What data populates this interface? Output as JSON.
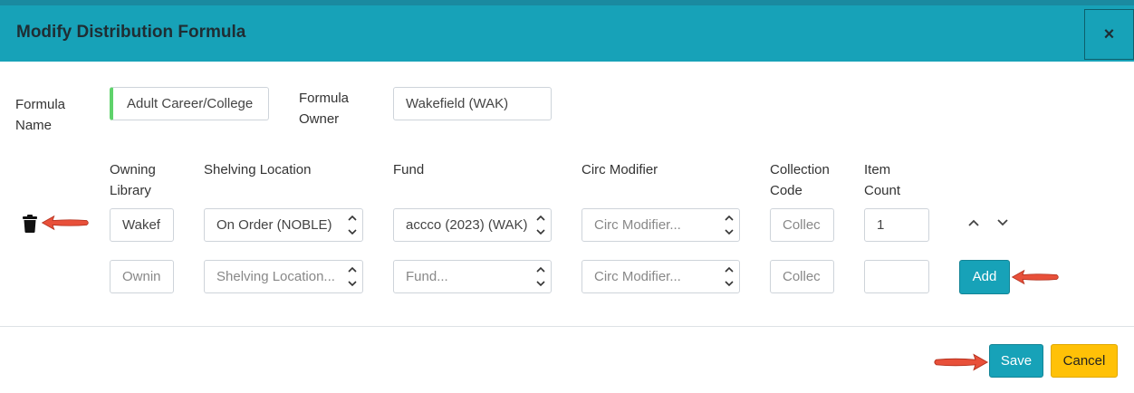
{
  "dialog": {
    "title": "Modify Distribution Formula",
    "close_label": "×"
  },
  "formula": {
    "name_label_1": "Formula",
    "name_label_2": "Name",
    "name_value": "Adult Career/College",
    "owner_label_1": "Formula",
    "owner_label_2": "Owner",
    "owner_value": "Wakefield (WAK)"
  },
  "columns": {
    "owning_library_1": "Owning",
    "owning_library_2": "Library",
    "shelving_location": "Shelving Location",
    "fund": "Fund",
    "circ_modifier": "Circ Modifier",
    "collection_code_1": "Collection",
    "collection_code_2": "Code",
    "item_count_1": "Item",
    "item_count_2": "Count"
  },
  "row1": {
    "owning_library": "Wakef",
    "shelving_location": "On Order (NOBLE)",
    "fund": "accco (2023) (WAK)",
    "circ_modifier_placeholder": "Circ Modifier...",
    "collection_code_placeholder": "Collec",
    "item_count": "1"
  },
  "row2": {
    "owning_library_placeholder": "Ownin",
    "shelving_location_placeholder": "Shelving Location...",
    "fund_placeholder": "Fund...",
    "circ_modifier_placeholder": "Circ Modifier...",
    "collection_code_placeholder": "Collec",
    "item_count": ""
  },
  "buttons": {
    "add": "Add",
    "save": "Save",
    "cancel": "Cancel"
  },
  "colors": {
    "header": "#17a2b8",
    "primary_button": "#17a2b8",
    "cancel_button": "#ffc107",
    "annotation_arrow": "#e8503a",
    "required_marker": "#5fd26b"
  },
  "icons": [
    "trash-icon",
    "close-icon",
    "chevron-up-icon",
    "chevron-down-icon",
    "spinner-icon",
    "annotation-arrow"
  ]
}
